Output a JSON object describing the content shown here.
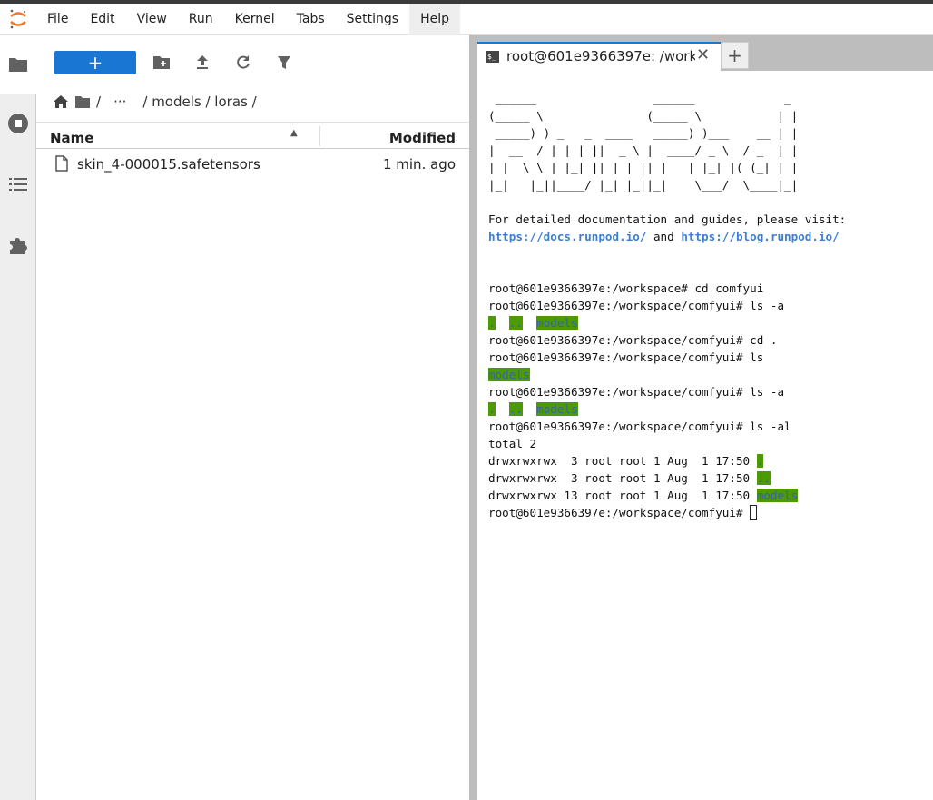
{
  "menu": [
    "File",
    "Edit",
    "View",
    "Run",
    "Kernel",
    "Tabs",
    "Settings",
    "Help"
  ],
  "browser": {
    "new_label": "+",
    "breadcrumb": {
      "root": "/",
      "ellipsis": "···",
      "path": "/ models / loras /"
    },
    "columns": {
      "name": "Name",
      "modified": "Modified"
    },
    "files": [
      {
        "name": "skin_4-000015.safetensors",
        "modified": "1 min. ago"
      }
    ]
  },
  "tabs": [
    {
      "label": "root@601e9366397e: /works",
      "icon_text": "$_"
    }
  ],
  "add_tab_label": "+",
  "terminal": {
    "banner": [
      " ______                 ______             _ ",
      "(_____ \\               (_____ \\           | |",
      " _____) ) _   _  ____   _____) )___    __ | |",
      "|  __  / | | | ||  _ \\ |  ____/ _ \\  / _  | |",
      "| |  \\ \\ | |_| || | | || |   | |_| |( (_| | |",
      "|_|   |_||____/ |_| |_||_|    \\___/  \\____|_|"
    ],
    "doc_line": "For detailed documentation and guides, please visit:",
    "link1": "https://docs.runpod.io/",
    "and": " and ",
    "link2": "https://blog.runpod.io/",
    "prompt_ws": "root@601e9366397e:/workspace# ",
    "prompt": "root@601e9366397e:/workspace/comfyui# ",
    "cmds": [
      "cd comfyui",
      "ls -a",
      "cd .",
      "ls",
      "ls -a",
      "ls -al"
    ],
    "total": "total 2",
    "ll": [
      {
        "perm": "drwxrwxrwx  3 root root 1 Aug  1 17:50 ",
        "name": "."
      },
      {
        "perm": "drwxrwxrwx  3 root root 1 Aug  1 17:50 ",
        "name": ".."
      },
      {
        "perm": "drwxrwxrwx 13 root root 1 Aug  1 17:50 ",
        "name": "models"
      }
    ],
    "entries": {
      "dot": ".",
      "dotdot": "..",
      "models": "models"
    }
  }
}
